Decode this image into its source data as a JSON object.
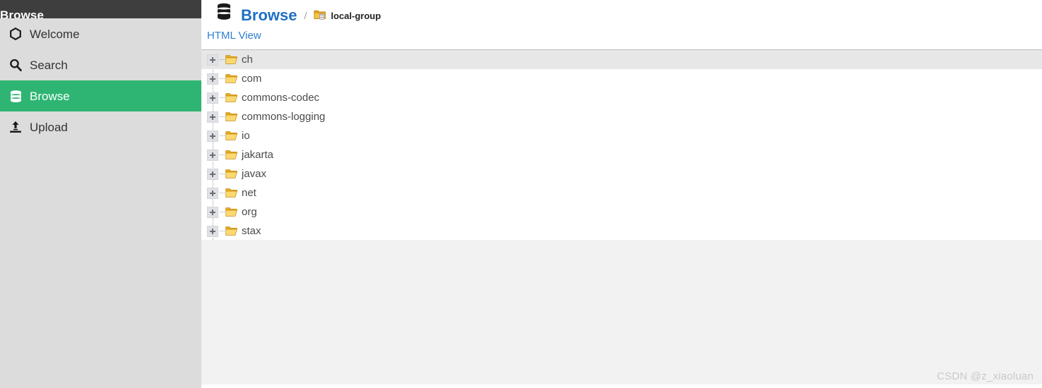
{
  "sidebar": {
    "header_title": "Browse",
    "items": [
      {
        "label": "Welcome",
        "icon": "hexagon-icon",
        "active": false
      },
      {
        "label": "Search",
        "icon": "search-icon",
        "active": false
      },
      {
        "label": "Browse",
        "icon": "database-icon",
        "active": true
      },
      {
        "label": "Upload",
        "icon": "upload-icon",
        "active": false
      }
    ]
  },
  "header": {
    "icon": "database-icon",
    "title": "Browse",
    "separator": "/",
    "breadcrumb_icon": "repository-folder-icon",
    "breadcrumb_label": "local-group"
  },
  "toolbar": {
    "view_link": "HTML View"
  },
  "tree": {
    "rows": [
      {
        "label": "ch",
        "icon": "folder-open-icon",
        "expander": "plus",
        "highlighted": true
      },
      {
        "label": "com",
        "icon": "folder-open-icon",
        "expander": "plus",
        "highlighted": false
      },
      {
        "label": "commons-codec",
        "icon": "folder-open-icon",
        "expander": "plus",
        "highlighted": false
      },
      {
        "label": "commons-logging",
        "icon": "folder-open-icon",
        "expander": "plus",
        "highlighted": false
      },
      {
        "label": "io",
        "icon": "folder-open-icon",
        "expander": "plus",
        "highlighted": false
      },
      {
        "label": "jakarta",
        "icon": "folder-open-icon",
        "expander": "plus",
        "highlighted": false
      },
      {
        "label": "javax",
        "icon": "folder-open-icon",
        "expander": "plus",
        "highlighted": false
      },
      {
        "label": "net",
        "icon": "folder-open-icon",
        "expander": "plus",
        "highlighted": false
      },
      {
        "label": "org",
        "icon": "folder-open-icon",
        "expander": "plus",
        "highlighted": false
      },
      {
        "label": "stax",
        "icon": "folder-open-icon",
        "expander": "plus",
        "highlighted": false
      }
    ]
  },
  "watermark": "CSDN @z_xiaoluan",
  "colors": {
    "accent_green": "#2eb573",
    "header_dark": "#3e3e3e",
    "sidebar_bg": "#dcdcdc",
    "link_blue": "#2f7fd1",
    "title_blue": "#1f6fc4",
    "folder_yellow": "#f2c14a",
    "row_highlight": "#e7e7e7",
    "panel_footer": "#f2f2f2"
  }
}
